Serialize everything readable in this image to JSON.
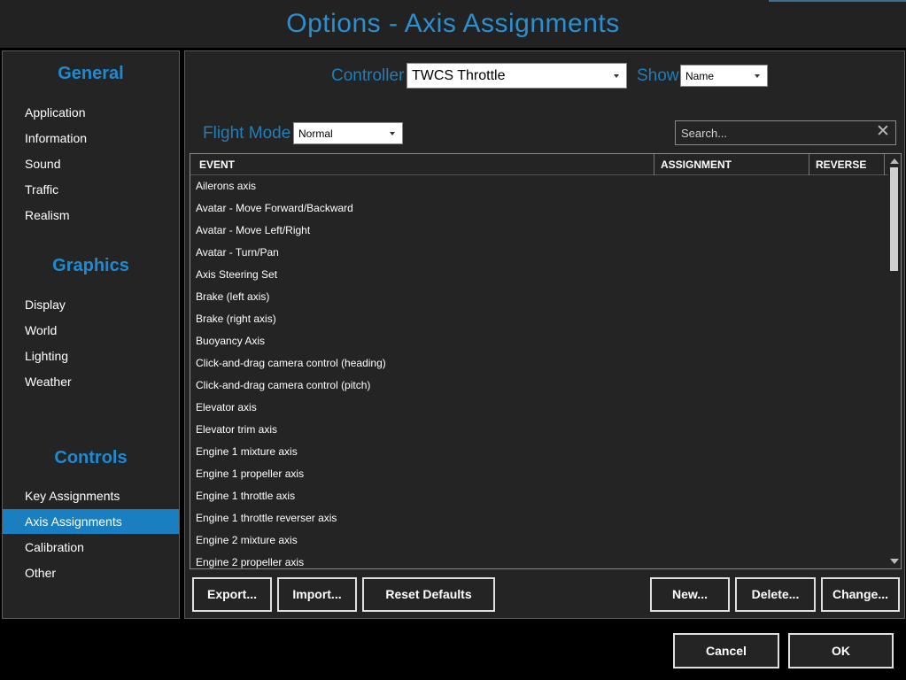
{
  "window": {
    "title": "Options - Axis Assignments"
  },
  "sidebar": {
    "sections": [
      {
        "title": "General",
        "items": [
          "Application",
          "Information",
          "Sound",
          "Traffic",
          "Realism"
        ]
      },
      {
        "title": "Graphics",
        "items": [
          "Display",
          "World",
          "Lighting",
          "Weather"
        ]
      },
      {
        "title": "Controls",
        "items": [
          "Key Assignments",
          "Axis Assignments",
          "Calibration",
          "Other"
        ]
      }
    ],
    "active_item": "Axis Assignments"
  },
  "controls": {
    "controller_label": "Controller",
    "controller_value": "TWCS Throttle",
    "show_label": "Show",
    "show_value": "Name",
    "flight_mode_label": "Flight Mode",
    "flight_mode_value": "Normal",
    "search_placeholder": "Search..."
  },
  "table": {
    "columns": [
      "EVENT",
      "ASSIGNMENT",
      "REVERSE"
    ],
    "rows": [
      "Ailerons axis",
      "Avatar - Move Forward/Backward",
      "Avatar - Move Left/Right",
      "Avatar - Turn/Pan",
      "Axis Steering Set",
      "Brake (left axis)",
      "Brake (right axis)",
      "Buoyancy Axis",
      "Click-and-drag camera control (heading)",
      "Click-and-drag camera control (pitch)",
      "Elevator axis",
      "Elevator trim axis",
      "Engine 1 mixture axis",
      "Engine 1 propeller axis",
      "Engine 1 throttle axis",
      "Engine 1 throttle reverser axis",
      "Engine 2 mixture axis",
      "Engine 2 propeller axis"
    ]
  },
  "buttons": {
    "export": "Export...",
    "import": "Import...",
    "reset": "Reset Defaults",
    "new": "New...",
    "delete": "Delete...",
    "change": "Change...",
    "cancel": "Cancel",
    "ok": "OK"
  },
  "colors": {
    "accent": "#1e8ad2",
    "active_nav": "#1a7fc0",
    "panel": "#242424",
    "background": "#000000"
  },
  "icons": {
    "search_clear": "close-icon",
    "dropdown": "chevron-down-icon"
  }
}
